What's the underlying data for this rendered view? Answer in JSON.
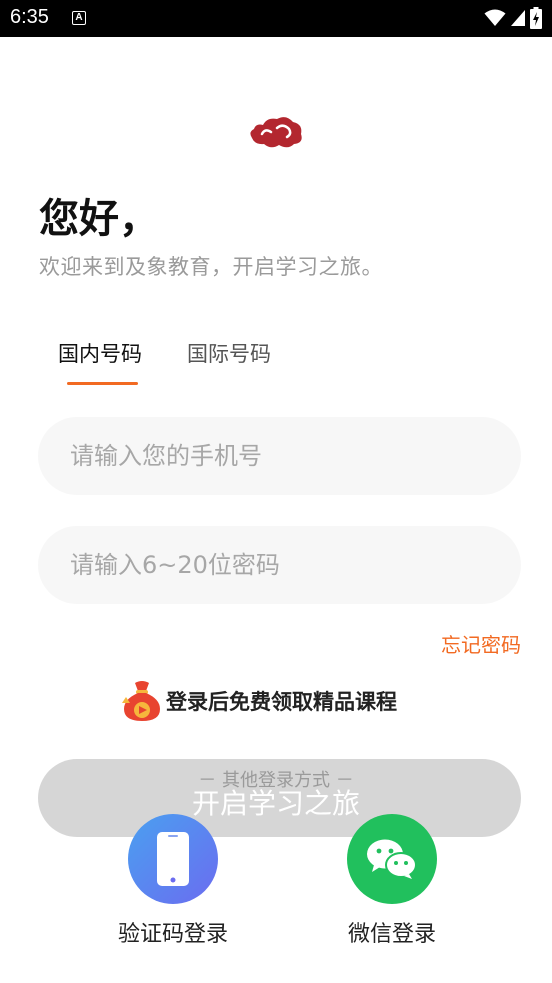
{
  "status_bar": {
    "time": "6:35",
    "notification_icon": "A"
  },
  "brand": {
    "logo_icon": "auspicious-cloud-icon",
    "accent_color": "#f26a22",
    "logo_color": "#b3272f"
  },
  "greeting": "您好，",
  "subtitle": "欢迎来到及象教育，开启学习之旅。",
  "tabs": [
    {
      "label": "国内号码",
      "active": true
    },
    {
      "label": "国际号码",
      "active": false
    }
  ],
  "phone_input": {
    "placeholder": "请输入您的手机号",
    "value": ""
  },
  "password_input": {
    "placeholder": "请输入6~20位密码",
    "value": ""
  },
  "forgot_password": "忘记密码",
  "promo_text": "登录后免费领取精品课程",
  "start_button": "开启学习之旅",
  "other_methods_label": "－ 其他登录方式 －",
  "alt_logins": [
    {
      "label": "验证码登录",
      "icon": "smartphone-icon"
    },
    {
      "label": "微信登录",
      "icon": "wechat-icon"
    }
  ]
}
